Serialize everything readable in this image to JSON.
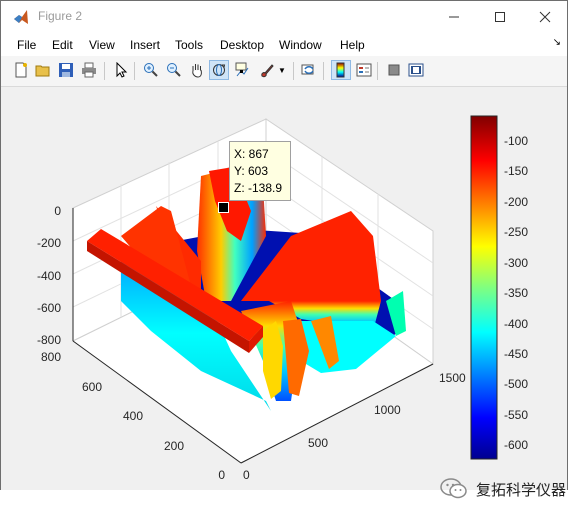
{
  "window": {
    "title": "Figure 2",
    "controls": {
      "minimize_icon": "minimize-icon",
      "maximize_icon": "maximize-icon",
      "close_icon": "close-icon"
    }
  },
  "menubar": {
    "items": [
      "File",
      "Edit",
      "View",
      "Insert",
      "Tools",
      "Desktop",
      "Window",
      "Help"
    ]
  },
  "toolbar": {
    "buttons": [
      "new-figure",
      "open-file",
      "save",
      "print",
      "edit-plot",
      "zoom-in",
      "zoom-out",
      "pan",
      "rotate-3d",
      "data-cursor",
      "brush",
      "link-plot",
      "colorbar",
      "legend",
      "hide-plot-tools",
      "show-plot-tools"
    ],
    "active": [
      "rotate-3d",
      "colorbar"
    ]
  },
  "plot": {
    "z_ticks": [
      "0",
      "-200",
      "-400",
      "-600",
      "-800"
    ],
    "y_ticks": [
      "800",
      "600",
      "400",
      "200",
      "0"
    ],
    "x_ticks": [
      "0",
      "500",
      "1000",
      "1500"
    ],
    "colorbar": {
      "ticks": [
        "-100",
        "-150",
        "-200",
        "-250",
        "-300",
        "-350",
        "-400",
        "-450",
        "-500",
        "-550",
        "-600"
      ],
      "colormap": "jet",
      "range": [
        -640,
        -70
      ]
    },
    "datatip": {
      "x": "X: 867",
      "y": "Y: 603",
      "z": "Z: -138.9"
    }
  },
  "watermark": {
    "text": "复拓科学仪器"
  },
  "colors": {
    "accent": "#1f5fbf",
    "wechat_green": "#2aae67"
  }
}
